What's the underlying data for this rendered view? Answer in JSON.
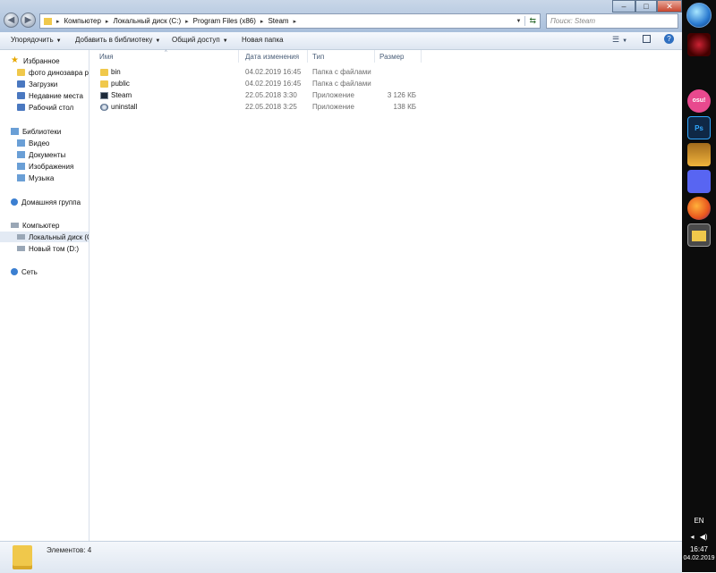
{
  "address_bar": {
    "breadcrumbs": [
      "Компьютер",
      "Локальный диск (C:)",
      "Program Files (x86)",
      "Steam"
    ]
  },
  "search": {
    "placeholder": "Поиск: Steam"
  },
  "window_controls": {
    "minimize": "–",
    "maximize": "□",
    "close": "✕"
  },
  "toolbar": {
    "organize": "Упорядочить",
    "add_to_library": "Добавить в библиотеку",
    "share": "Общий доступ",
    "new_folder": "Новая папка"
  },
  "nav_pane": {
    "favorites_label": "Избранное",
    "favorites": [
      "фото динозавра ре",
      "Загрузки",
      "Недавние места",
      "Рабочий стол"
    ],
    "libraries_label": "Библиотеки",
    "libraries": [
      "Видео",
      "Документы",
      "Изображения",
      "Музыка"
    ],
    "homegroup": "Домашняя группа",
    "computer_label": "Компьютер",
    "drives": [
      "Локальный диск (C",
      "Новый том (D:)"
    ],
    "network": "Сеть"
  },
  "columns": {
    "name": "Имя",
    "date": "Дата изменения",
    "type": "Тип",
    "size": "Размер"
  },
  "files": [
    {
      "name": "bin",
      "date": "04.02.2019 16:45",
      "type": "Папка с файлами",
      "size": "",
      "icon": "folder-icon"
    },
    {
      "name": "public",
      "date": "04.02.2019 16:45",
      "type": "Папка с файлами",
      "size": "",
      "icon": "folder-icon"
    },
    {
      "name": "Steam",
      "date": "22.05.2018 3:30",
      "type": "Приложение",
      "size": "3 126 КБ",
      "icon": "steam-app-icon"
    },
    {
      "name": "uninstall",
      "date": "22.05.2018 3:25",
      "type": "Приложение",
      "size": "138 КБ",
      "icon": "uninstall-icon"
    }
  ],
  "status": {
    "item_count": "Элементов: 4"
  },
  "taskbar": {
    "apps": [
      "browser-icon",
      "osu-icon",
      "photoshop-icon",
      "counter-strike-icon",
      "discord-icon",
      "firefox-icon",
      "explorer-icon"
    ],
    "photoshop_label": "Ps",
    "osu_label": "osu!",
    "language": "EN",
    "time": "16:47",
    "date": "04.02.2019"
  },
  "colors": {
    "accent": "#4a78c0",
    "folder": "#f0c84b",
    "taskbar": "#0c0c0c",
    "discord": "#5865f2",
    "osu": "#e8498e",
    "photoshop": "#0f2846"
  }
}
